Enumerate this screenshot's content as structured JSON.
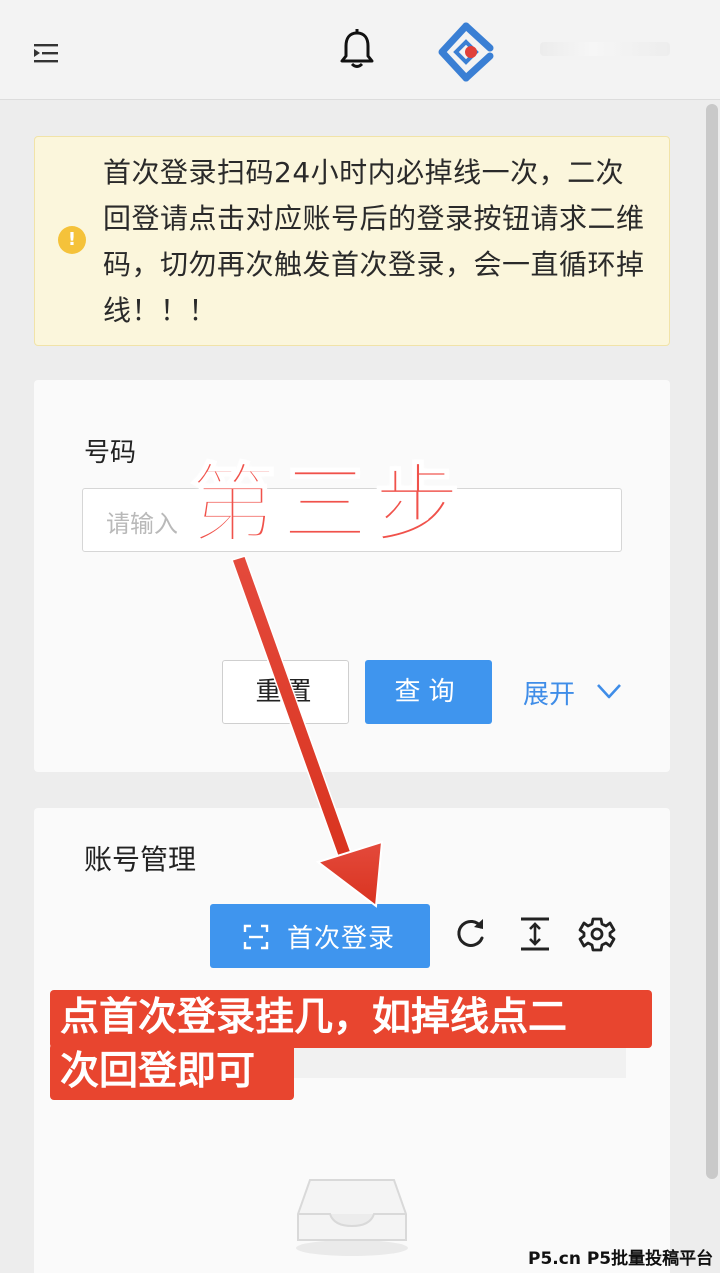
{
  "header": {
    "menu_icon": "menu-fold-icon",
    "bell_icon": "bell-icon",
    "logo_icon": "diamond-logo-icon"
  },
  "notice": {
    "icon": "warning-icon",
    "text": "首次登录扫码24小时内必掉线一次，二次回登请点击对应账号后的登录按钮请求二维码，切勿再次触发首次登录，会一直循环掉线！！！"
  },
  "search": {
    "label": "号码",
    "placeholder": "请输入",
    "reset_label": "重置",
    "query_label": "查询",
    "expand_label": "展开"
  },
  "accounts": {
    "title": "账号管理",
    "first_login_label": "首次登录"
  },
  "overlay": {
    "step_text": "第三步",
    "banner_line1": "点首次登录挂几，如掉线点二",
    "banner_line2": "次回登即可",
    "arrow_color": "#e63b2e"
  },
  "watermark": "P5.cn P5批量投稿平台",
  "colors": {
    "primary": "#3f95ee",
    "notice_bg": "#fbf6dc",
    "banner_red": "#e8452f",
    "step_red": "#f0524b"
  }
}
